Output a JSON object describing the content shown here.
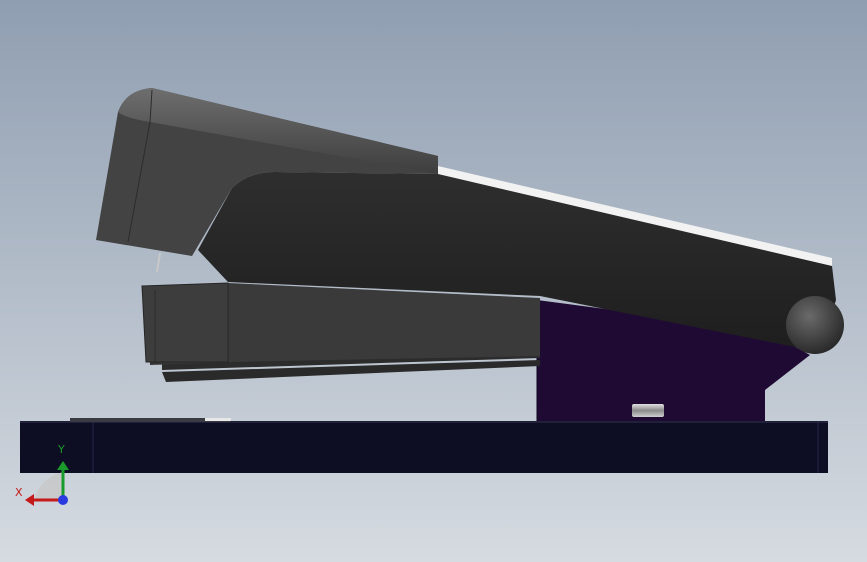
{
  "viewport": {
    "background_top": "#bec6d0",
    "background_bottom": "#f1f3f5"
  },
  "model": {
    "body_color": "#3a3a3a",
    "arm_color": "#242424",
    "bracket_color": "#1f0a33",
    "base_color": "#0d0d24",
    "strip_color": "#f2f2f2"
  },
  "triad": {
    "x_label": "X",
    "y_label": "Y",
    "x_color": "#c41a1a",
    "y_color": "#1a9a2a",
    "z_color": "#2a3ae0"
  }
}
